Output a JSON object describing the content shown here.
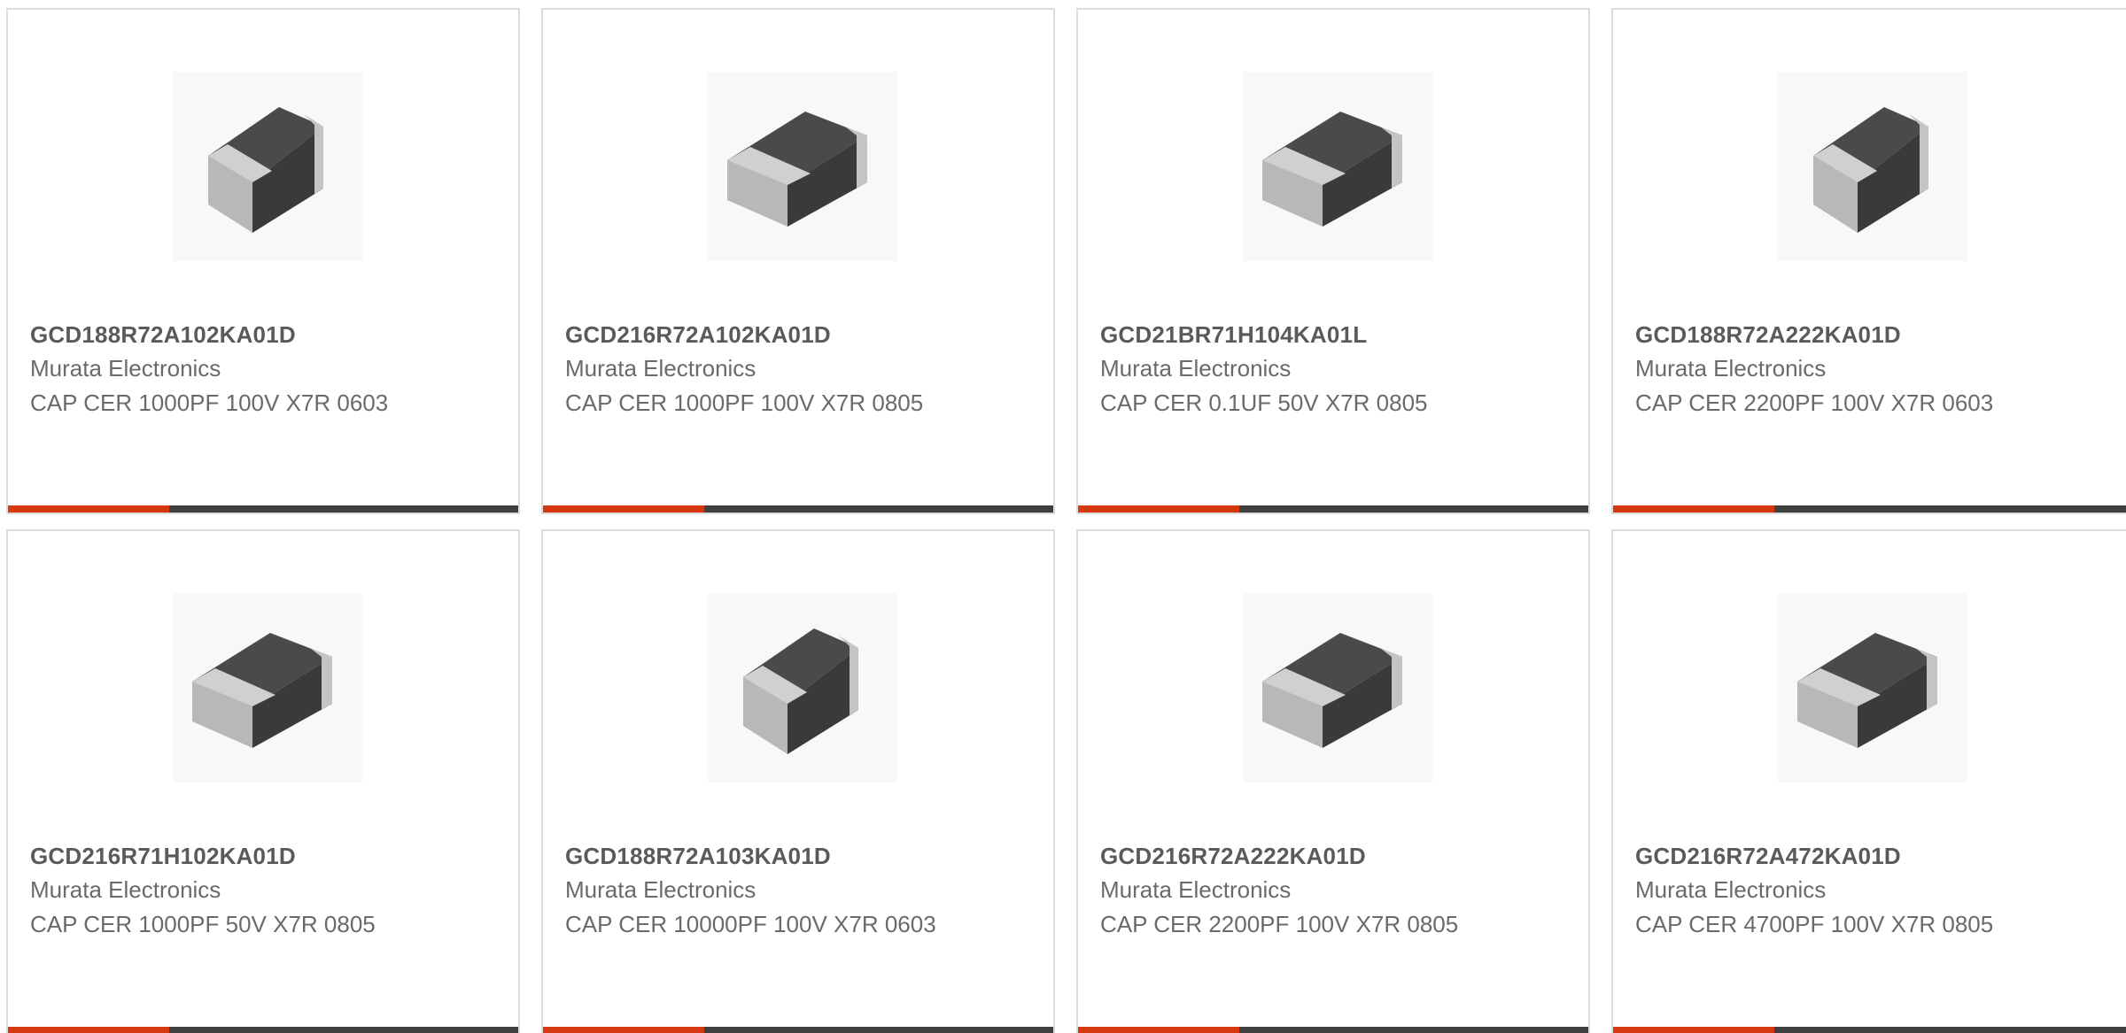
{
  "colors": {
    "accent": "#d6380f",
    "bar": "#3f3f3f",
    "border": "#dcdcdc",
    "text": "#5a5a5a"
  },
  "products": [
    {
      "part_number": "GCD188R72A102KA01D",
      "manufacturer": "Murata Electronics",
      "description": "CAP CER 1000PF 100V X7R 0603",
      "image_icon": "capacitor-chip-icon"
    },
    {
      "part_number": "GCD216R72A102KA01D",
      "manufacturer": "Murata Electronics",
      "description": "CAP CER 1000PF 100V X7R 0805",
      "image_icon": "capacitor-chip-icon"
    },
    {
      "part_number": "GCD21BR71H104KA01L",
      "manufacturer": "Murata Electronics",
      "description": "CAP CER 0.1UF 50V X7R 0805",
      "image_icon": "capacitor-chip-icon"
    },
    {
      "part_number": "GCD188R72A222KA01D",
      "manufacturer": "Murata Electronics",
      "description": "CAP CER 2200PF 100V X7R 0603",
      "image_icon": "capacitor-chip-icon"
    },
    {
      "part_number": "GCD216R71H102KA01D",
      "manufacturer": "Murata Electronics",
      "description": "CAP CER 1000PF 50V X7R 0805",
      "image_icon": "capacitor-chip-icon"
    },
    {
      "part_number": "GCD188R72A103KA01D",
      "manufacturer": "Murata Electronics",
      "description": "CAP CER 10000PF 100V X7R 0603",
      "image_icon": "capacitor-chip-icon"
    },
    {
      "part_number": "GCD216R72A222KA01D",
      "manufacturer": "Murata Electronics",
      "description": "CAP CER 2200PF 100V X7R 0805",
      "image_icon": "capacitor-chip-icon"
    },
    {
      "part_number": "GCD216R72A472KA01D",
      "manufacturer": "Murata Electronics",
      "description": "CAP CER 4700PF 100V X7R 0805",
      "image_icon": "capacitor-chip-icon"
    }
  ]
}
